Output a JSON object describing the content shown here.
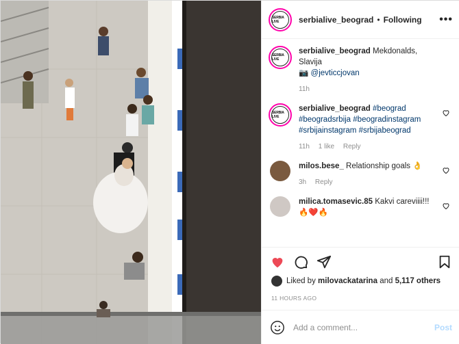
{
  "post": {
    "username": "serbialive_beograd",
    "follow_label": "Following",
    "avatar_logo_text": "SERBIA LIVE"
  },
  "comments": [
    {
      "username": "serbialive_beograd",
      "text": "Mekdonalds, Slavija",
      "credit": "@jevticcjovan",
      "time": "11h"
    },
    {
      "username": "serbialive_beograd",
      "text": "#beograd #beogradsrbija #beogradinstagram #srbijainstagram #srbijabeograd",
      "time": "11h",
      "likes": "1 like",
      "reply": "Reply"
    },
    {
      "username": "milos.bese_",
      "text": "Relationship goals 👌",
      "time": "3h",
      "reply": "Reply"
    },
    {
      "username": "milica.tomasevic.85",
      "text": "Kakvi careviiii!!! 🔥❤️🔥"
    }
  ],
  "likes": {
    "liked_by_prefix": "Liked by",
    "liked_by_user": "milovackatarina",
    "and": "and",
    "others": "5,117 others"
  },
  "time_ago": "11 HOURS AGO",
  "comment_box": {
    "placeholder": "Add a comment...",
    "post_label": "Post"
  },
  "colors": {
    "like_red": "#ed4956",
    "link_blue": "#00376b",
    "post_disabled": "#b3dbff"
  }
}
